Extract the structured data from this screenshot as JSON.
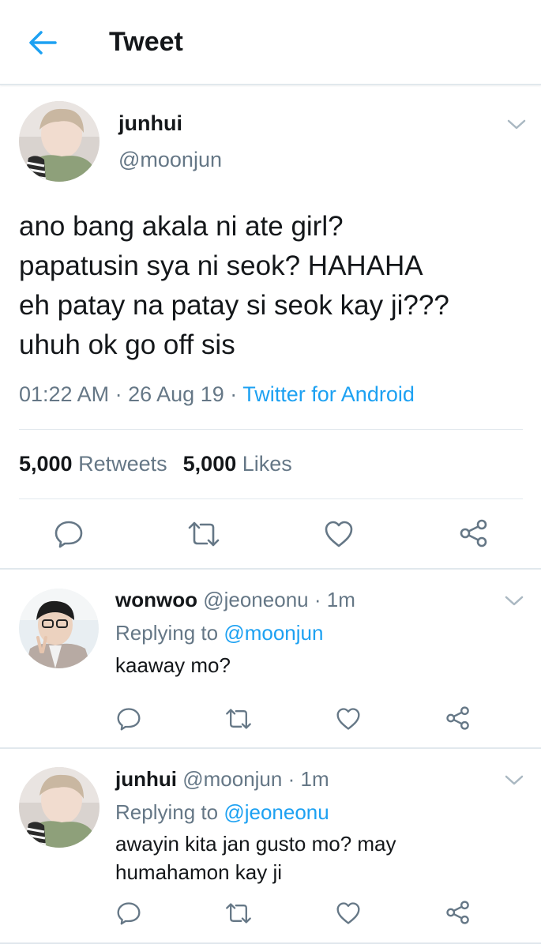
{
  "header": {
    "title": "Tweet"
  },
  "main_tweet": {
    "name": "junhui",
    "handle": "@moonjun",
    "text_lines": [
      "ano bang akala ni ate girl?",
      "papatusin sya ni seok? HAHAHA",
      "eh patay na patay si seok kay ji???",
      "uhuh ok go off sis"
    ],
    "time": "01:22 AM",
    "date": "26 Aug 19",
    "source": "Twitter for Android",
    "retweets_count": "5,000",
    "retweets_label": "Retweets",
    "likes_count": "5,000",
    "likes_label": "Likes"
  },
  "replies": [
    {
      "name": "wonwoo",
      "handle": "@jeoneonu",
      "time": "1m",
      "replying_label": "Replying to",
      "replying_to": "@moonjun",
      "text_lines": [
        "kaaway mo?"
      ]
    },
    {
      "name": "junhui",
      "handle": "@moonjun",
      "time": "1m",
      "replying_label": "Replying to",
      "replying_to": "@jeoneonu",
      "text_lines": [
        "awayin kita jan gusto mo? may",
        "humahamon kay ji"
      ]
    }
  ],
  "separator": "·",
  "colors": {
    "accent": "#1da1f2",
    "text": "#14171a",
    "muted": "#657786",
    "icon": "#657786",
    "divider": "#e1e8ed"
  },
  "icons": [
    "back-arrow-icon",
    "chevron-down-icon",
    "reply-icon",
    "retweet-icon",
    "like-icon",
    "share-icon"
  ]
}
